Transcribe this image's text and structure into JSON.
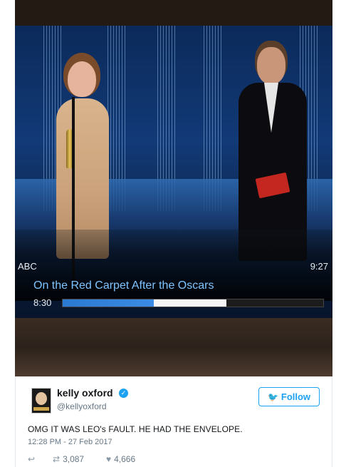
{
  "tv": {
    "network": "ABC",
    "clock": "9:27",
    "program_title": "On the Red Carpet After the Oscars",
    "program_time": "8:30",
    "progress_fraction": 0.35,
    "buffer_fraction": 0.63
  },
  "tweet": {
    "name": "kelly oxford",
    "handle": "@kellyoxford",
    "follow_label": "Follow",
    "text": "OMG IT WAS LEO's FAULT. HE HAD THE ENVELOPE.",
    "timestamp": "12:28 PM - 27 Feb 2017",
    "retweets": "3,087",
    "likes": "4,666"
  },
  "icons": {
    "verified": "verified-badge-icon",
    "reply": "reply-icon",
    "retweet": "retweet-icon",
    "like": "heart-icon",
    "follow": "twitter-bird-icon"
  },
  "colors": {
    "accent": "#1da1f2",
    "progress_blue": "#2b7ad1",
    "program_text": "#7fc4ff"
  }
}
